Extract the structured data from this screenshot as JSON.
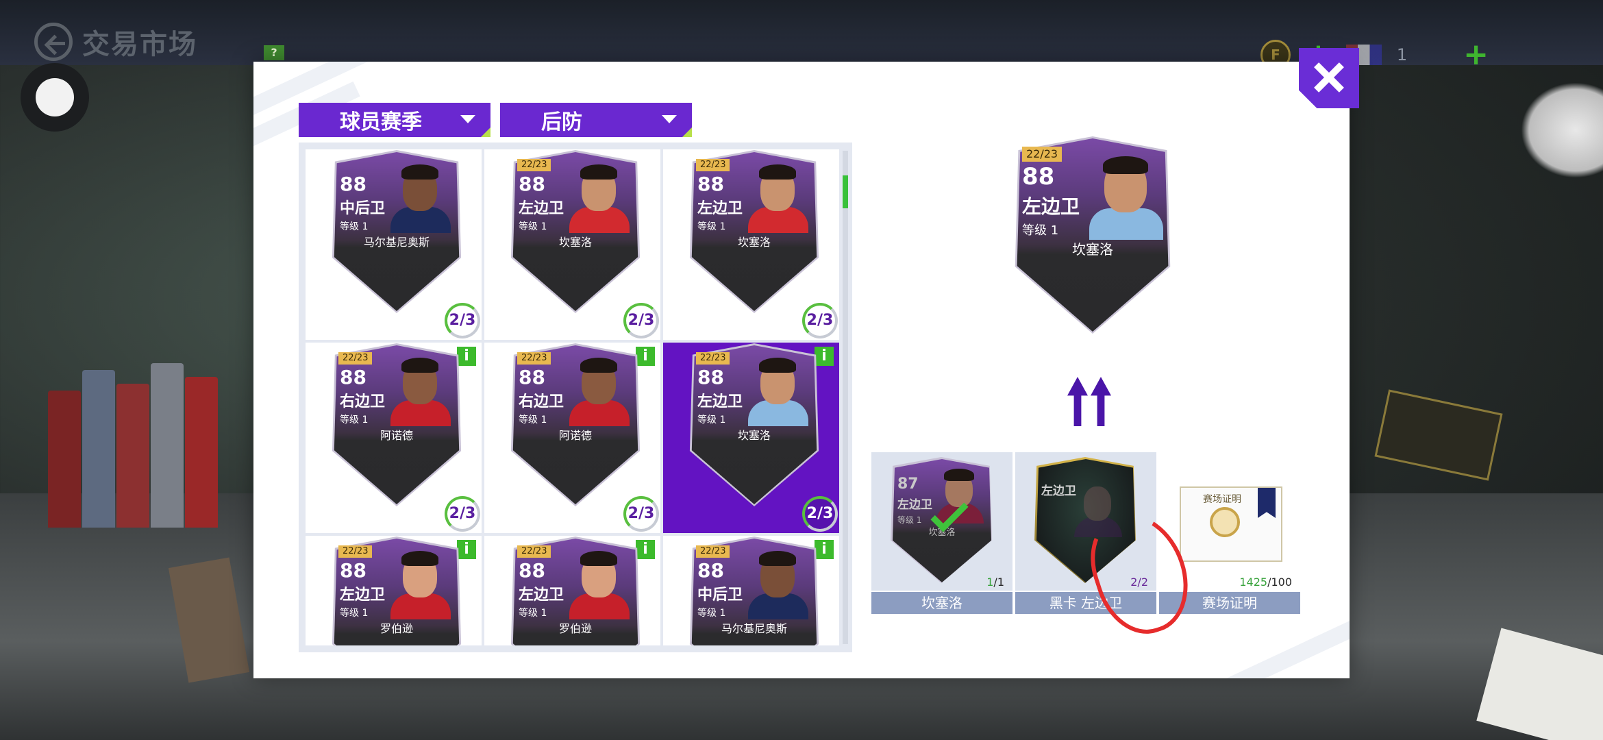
{
  "hud": {
    "title": "交易市场",
    "help": "?",
    "currency_count": "1"
  },
  "filters": [
    {
      "label": "球员赛季"
    },
    {
      "label": "后防"
    }
  ],
  "cards": [
    {
      "season": "",
      "rating": "88",
      "position": "中后卫",
      "level": "等级 1",
      "name": "马尔基尼奥斯",
      "count": "2/3",
      "info": false,
      "selected": false,
      "skin": "#7a4f38",
      "jersey": "#1d2b5c"
    },
    {
      "season": "22/23",
      "rating": "88",
      "position": "左边卫",
      "level": "等级 1",
      "name": "坎塞洛",
      "count": "2/3",
      "info": false,
      "selected": false,
      "skin": "#c9936f",
      "jersey": "#d22a2f"
    },
    {
      "season": "22/23",
      "rating": "88",
      "position": "左边卫",
      "level": "等级 1",
      "name": "坎塞洛",
      "count": "2/3",
      "info": false,
      "selected": false,
      "skin": "#c9936f",
      "jersey": "#d22a2f"
    },
    {
      "season": "22/23",
      "rating": "88",
      "position": "右边卫",
      "level": "等级 1",
      "name": "阿诺德",
      "count": "2/3",
      "info": true,
      "selected": false,
      "skin": "#8a5a40",
      "jersey": "#c6202a"
    },
    {
      "season": "22/23",
      "rating": "88",
      "position": "右边卫",
      "level": "等级 1",
      "name": "阿诺德",
      "count": "2/3",
      "info": true,
      "selected": false,
      "skin": "#8a5a40",
      "jersey": "#c6202a"
    },
    {
      "season": "22/23",
      "rating": "88",
      "position": "左边卫",
      "level": "等级 1",
      "name": "坎塞洛",
      "count": "2/3",
      "info": true,
      "selected": true,
      "skin": "#c9936f",
      "jersey": "#8ab8e0"
    },
    {
      "season": "22/23",
      "rating": "88",
      "position": "左边卫",
      "level": "等级 1",
      "name": "罗伯逊",
      "count": "",
      "info": true,
      "selected": false,
      "skin": "#d9a07f",
      "jersey": "#c6202a"
    },
    {
      "season": "22/23",
      "rating": "88",
      "position": "左边卫",
      "level": "等级 1",
      "name": "罗伯逊",
      "count": "",
      "info": true,
      "selected": false,
      "skin": "#d9a07f",
      "jersey": "#c6202a"
    },
    {
      "season": "22/23",
      "rating": "88",
      "position": "中后卫",
      "level": "等级 1",
      "name": "马尔基尼奥斯",
      "count": "",
      "info": true,
      "selected": false,
      "skin": "#7a4f38",
      "jersey": "#1d2b5c"
    }
  ],
  "info_label": "i",
  "preview": {
    "season": "22/23",
    "rating": "88",
    "position": "左边卫",
    "level": "等级 1",
    "name": "坎塞洛"
  },
  "requirements": [
    {
      "label": "坎塞洛",
      "count": "1",
      "total": "/1",
      "mini_rating": "87",
      "mini_position": "左边卫",
      "mini_level": "等级 1",
      "mini_name": "坎塞洛"
    },
    {
      "label": "黑卡 左边卫",
      "count": "2/2",
      "total": "",
      "mini_position": "左边卫"
    },
    {
      "label": "赛场证明",
      "count": "1425",
      "total": "/100",
      "cert_title": "赛场证明"
    }
  ],
  "colors": {
    "accent_purple": "#6a28d0",
    "selected_slot": "#6313c2",
    "info_green": "#3cba2c",
    "annotation_red": "#e62c2c"
  }
}
